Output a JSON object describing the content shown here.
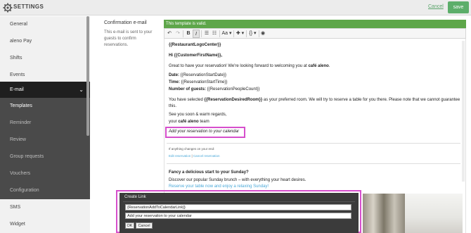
{
  "topbar": {
    "title": "SETTINGS",
    "icon": "gear-icon",
    "cancel_label": "Cancel",
    "save_label": "save",
    "accent": "#5cae6a"
  },
  "sidebar": {
    "items": [
      {
        "label": "General"
      },
      {
        "label": "aleno Pay"
      },
      {
        "label": "Shifts"
      },
      {
        "label": "Events"
      },
      {
        "label": "E-mail"
      },
      {
        "label": "Templates"
      },
      {
        "label": "Reminder"
      },
      {
        "label": "Review"
      },
      {
        "label": "Group requests"
      },
      {
        "label": "Vouchers"
      },
      {
        "label": "Configuration"
      },
      {
        "label": "SMS"
      },
      {
        "label": "Widget"
      }
    ]
  },
  "section": {
    "title": "Confirmation e-mail",
    "description": "This e-mail is sent to your guests to confirm reservations."
  },
  "editor": {
    "valid_message": "This template is valid.",
    "valid_color": "#5ea64a",
    "toolbar": {
      "undo": "↶",
      "redo": "↷",
      "bold": "B",
      "italic": "I",
      "bullets": "☰",
      "numbers": "☷",
      "font": "Aa ▾",
      "insert": "✚ ▾",
      "braces": "{} ▾",
      "preview": "◉"
    },
    "content": {
      "logo": "{{RestaurantLogoCenter}}",
      "greeting": "Hi {{CustomerFirstName}},",
      "intro_prefix": "Great to have your reservation! We're looking forward to welcoming you at ",
      "intro_venue": "café aleno",
      "intro_suffix": ".",
      "date_label": "Date:",
      "date_value": " {{ReservationStartDate}}",
      "time_label": "Time:",
      "time_value": " {{ReservationStartTime}}",
      "guests_label": "Number of guests:",
      "guests_value": " {{ReservationPeopleCount}}",
      "room_prefix": "You have selected ",
      "room_value": "{{ReservationDesiredRoom}}",
      "room_suffix": " as your preferred room. We will try to reserve a table for you there. Please note that we cannot guarantee",
      "room_line2": "this.",
      "signoff1": "See you soon & warm regards,",
      "signoff2_prefix": "your ",
      "signoff2_venue": "café aleno",
      "signoff2_suffix": " team",
      "calendar_link": "Add your reservation to your calendar",
      "changes_note": "If anything changes on your end:",
      "edit_link": "Edit reservation",
      "divider": " | ",
      "cancel_link": "Cancel reservation",
      "promo_title": "Fancy a delicious start to your Sunday?",
      "promo_text": "Discover our popular Sunday brunch – with everything your heart desires.",
      "promo_link": "Reserve your table now and enjoy a relaxing Sunday!"
    }
  },
  "dialog": {
    "title": "Create Link",
    "url_value": "{ReservationAddToCalendarLink}}",
    "text_value": "Add your reservation to your calendar",
    "ok_label": "OK",
    "cancel_label": "Cancel"
  }
}
